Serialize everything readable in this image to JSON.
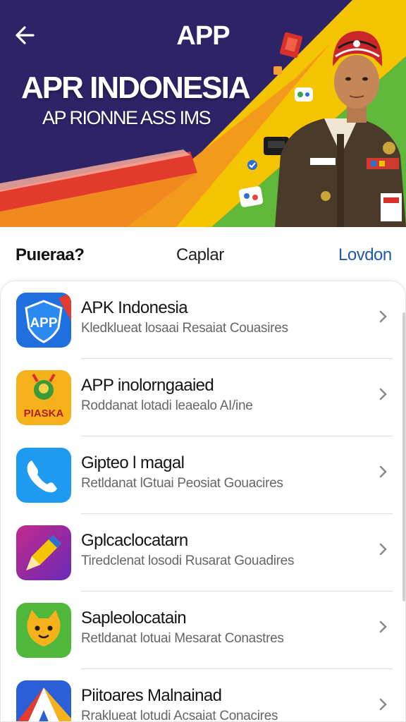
{
  "header": {
    "title": "APP",
    "back_icon": "arrow-left-icon"
  },
  "hero": {
    "heading": "APR INDONESIA",
    "subheading": "AP RIONNE ASS IMS"
  },
  "tabs": [
    {
      "label": "Puıeraa?"
    },
    {
      "label": "Caplar"
    },
    {
      "label": "Lovdon"
    }
  ],
  "apps": [
    {
      "title": "APK Indonesia",
      "desc": "Kledklueat losaai  Resaiat Couasires",
      "icon": "app-shield-icon",
      "icon_text": "APP"
    },
    {
      "title": "APP inolorngaaied",
      "desc": "Roddanat lotadi  leaealo AI/ine",
      "icon": "piaska-badge-icon",
      "icon_text": "PIASKA"
    },
    {
      "title": "Gipteo l magal",
      "desc": "Retldanat lGtuai  Peosiat Gouacires",
      "icon": "phone-icon"
    },
    {
      "title": "Gplcaclocatarn",
      "desc": "Tiredclenat losodi  Rusarat Gouadires",
      "icon": "pencil-icon"
    },
    {
      "title": "Sapleolocatain",
      "desc": "Retldanat lotuai  Mesarat Conastres",
      "icon": "cat-face-icon"
    },
    {
      "title": "Piitoares Malnainad",
      "desc": "Rraklueat lotudi  Acsaiat Conacires",
      "icon": "triangle-logo-icon"
    }
  ],
  "colors": {
    "hero_bg": "#2e2366",
    "accent_yellow": "#f5c400",
    "accent_green": "#5fb83a",
    "accent_red": "#e23b2e",
    "tab_link": "#1e5aa8"
  }
}
